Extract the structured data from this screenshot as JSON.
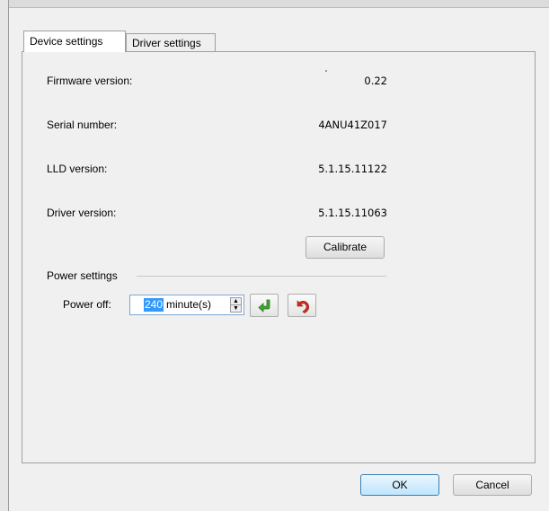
{
  "tabs": [
    {
      "label": "Device settings",
      "active": true
    },
    {
      "label": "Driver settings",
      "active": false
    }
  ],
  "device": {
    "firmware_label": "Firmware version:",
    "firmware_value": "0.22",
    "serial_label": "Serial number:",
    "serial_value": "4ANU41Z017",
    "lld_label": "LLD version:",
    "lld_value": "5.1.15.11122",
    "driver_label": "Driver version:",
    "driver_value": "5.1.15.11063",
    "calibrate_label": "Calibrate"
  },
  "power": {
    "group_label": "Power settings",
    "power_off_label": "Power off:",
    "value": "240",
    "unit": "minute(s)",
    "apply_icon": "green-enter-arrow-icon",
    "undo_icon": "red-undo-arrow-icon"
  },
  "footer": {
    "ok_label": "OK",
    "cancel_label": "Cancel"
  },
  "colors": {
    "accent_green": "#3fa535",
    "accent_red": "#d42a1c",
    "selection": "#3399ff"
  }
}
